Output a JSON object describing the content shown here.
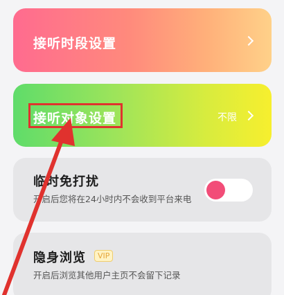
{
  "time_setting": {
    "label": "接听时段设置"
  },
  "target_setting": {
    "label": "接听对象设置",
    "value": "不限"
  },
  "do_not_disturb": {
    "title": "临时免打扰",
    "description": "开启后您将在24小时内不会收到平台来电",
    "enabled": false
  },
  "stealth_browse": {
    "title": "隐身浏览",
    "badge": "VIP",
    "description": "开启后浏览其他用户主页不会留下记录"
  },
  "colors": {
    "highlight": "#e0322e",
    "toggle_knob": "#f24d78"
  },
  "icons": [
    "chevron-right-icon",
    "annotation-arrow"
  ]
}
